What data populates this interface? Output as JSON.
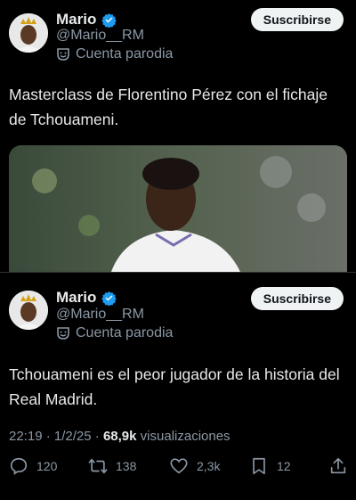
{
  "tweet1": {
    "name": "Mario",
    "handle": "@Mario__RM",
    "badge": "Cuenta parodia",
    "subscribe_label": "Suscribirse",
    "text": "Masterclass de Florentino Pérez con el fichaje de Tchouameni."
  },
  "tweet2": {
    "name": "Mario",
    "handle": "@Mario__RM",
    "badge": "Cuenta parodia",
    "subscribe_label": "Suscribirse",
    "text": "Tchouameni es el peor jugador de la historia del Real Madrid."
  },
  "meta": {
    "time": "22:19",
    "sep": "·",
    "date": "1/2/25",
    "views_count": "68,9k",
    "views_label": "visualizaciones"
  },
  "actions": {
    "replies": "120",
    "reposts": "138",
    "likes": "2,3k",
    "bookmarks": "12"
  },
  "colors": {
    "background": "#000000",
    "text": "#e7e9ea",
    "secondary": "#8b98a5",
    "verified": "#1d9bf0",
    "button_bg": "#eff3f4"
  }
}
